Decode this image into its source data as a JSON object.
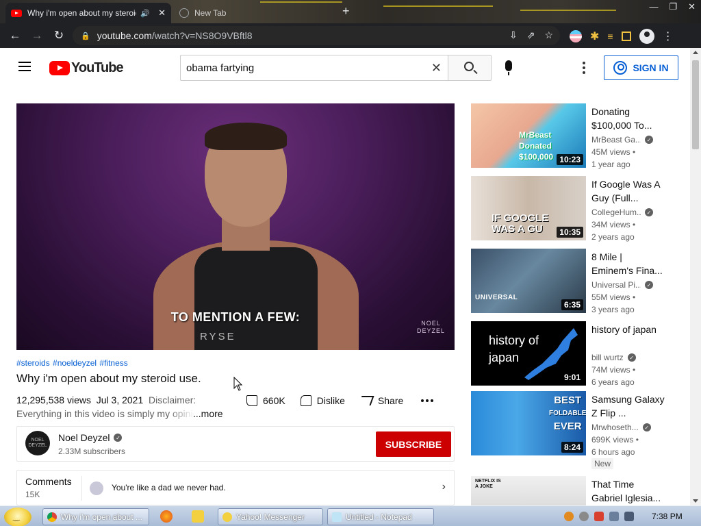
{
  "browser": {
    "tabs": [
      {
        "title": "Why i'm open about my steroid use.",
        "active": true
      },
      {
        "title": "New Tab",
        "active": false
      }
    ],
    "url_host": "youtube.com",
    "url_path": "/watch?v=NS8O9VBftl8"
  },
  "masthead": {
    "logo_text": "YouTube",
    "search_value": "obama fartying",
    "signin_label": "SIGN IN"
  },
  "video": {
    "caption": "TO MENTION A FEW:",
    "watermark_line1": "NOEL",
    "watermark_line2": "DEYZEL",
    "shirt_text": "RYSE",
    "hashtags": "#steroids #noeldeyzel #fitness",
    "title": "Why i'm open about my steroid use.",
    "views": "12,295,538 views",
    "date": "Jul 3, 2021",
    "disclaimer": "Disclaimer:",
    "description": "Everything in this video is simply my opinion",
    "more_label": "...more",
    "likes": "660K",
    "dislike_label": "Dislike",
    "share_label": "Share"
  },
  "channel": {
    "avatar_text": "NOEL DEYZEL",
    "name": "Noel Deyzel",
    "subscribers": "2.33M subscribers",
    "subscribe_label": "SUBSCRIBE"
  },
  "comments": {
    "label": "Comments",
    "count": "15K",
    "top_comment": "You're like a dad we never had."
  },
  "recommendations": [
    {
      "title": "Donating $100,000 To...",
      "channel": "MrBeast Ga...",
      "verified": true,
      "views": "45M views •",
      "age": "1 year ago",
      "duration": "10:23",
      "thumb_text": "MrBeast Donated $100,000"
    },
    {
      "title": "If Google Was A Guy (Full...",
      "channel": "CollegeHum...",
      "verified": true,
      "views": "34M views •",
      "age": "2 years ago",
      "duration": "10:35",
      "thumb_text_1": "IF GOOGLE",
      "thumb_text_2": "WAS A GU"
    },
    {
      "title": "8 Mile | Eminem's Fina...",
      "channel": "Universal Pi...",
      "verified": true,
      "views": "55M views •",
      "age": "3 years ago",
      "duration": "6:35",
      "thumb_text": "UNIVERSAL"
    },
    {
      "title": "history of japan",
      "channel": "bill wurtz",
      "verified": true,
      "views": "74M views •",
      "age": "6 years ago",
      "duration": "9:01",
      "thumb_text_1": "history of",
      "thumb_text_2": "japan"
    },
    {
      "title": "Samsung Galaxy Z Flip ...",
      "channel": "Mrwhoseth...",
      "verified": true,
      "views": "699K views •",
      "age": "6 hours ago",
      "duration": "8:24",
      "badge": "New",
      "thumb_text_1": "BEST",
      "thumb_text_2": "FOLDABLE",
      "thumb_text_3": "EVER"
    },
    {
      "title": "That Time Gabriel Iglesia...",
      "channel": "",
      "verified": false,
      "views": "",
      "age": "",
      "duration": "",
      "thumb_text": "NETFLIX IS A JOKE"
    }
  ],
  "taskbar": {
    "items": [
      {
        "label": "Why i'm open about ..."
      },
      {
        "label": "Yahoo! Messenger"
      },
      {
        "label": "Untitled - Notepad"
      }
    ],
    "clock": "7:38 PM"
  },
  "colors": {
    "youtube_red": "#ff0000",
    "subscribe_red": "#cc0000",
    "link_blue": "#065fd4",
    "chrome_dark": "#202124"
  }
}
